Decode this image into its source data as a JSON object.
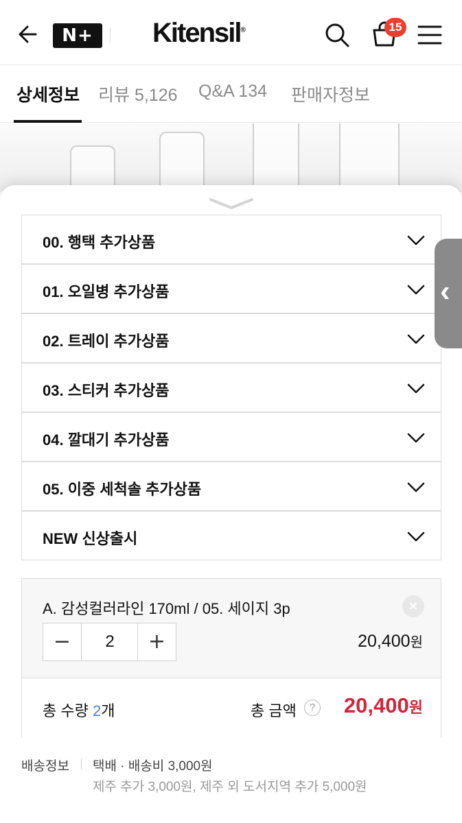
{
  "header": {
    "nplus_label": "N+",
    "logo_text": "Kitensil",
    "logo_mark": "®",
    "cart_count": "15",
    "icons": [
      "back-arrow-icon",
      "search-icon",
      "cart-icon",
      "hamburger-menu-icon"
    ]
  },
  "tabs": [
    {
      "label": "상세정보",
      "active": true
    },
    {
      "label": "리뷰 5,126",
      "active": false
    },
    {
      "label": "Q&A 134",
      "active": false
    },
    {
      "label": "판매자정보",
      "active": false
    }
  ],
  "options": [
    {
      "label": "00. 행택 추가상품"
    },
    {
      "label": "01. 오일병 추가상품"
    },
    {
      "label": "02. 트레이 추가상품"
    },
    {
      "label": "03. 스티커 추가상품"
    },
    {
      "label": "04. 깔대기 추가상품"
    },
    {
      "label": "05. 이중 세척솔 추가상품"
    },
    {
      "label": "NEW 신상출시"
    }
  ],
  "selected": {
    "name": "A. 감성컬러라인 170ml / 05. 세이지 3p",
    "minus": "−",
    "quantity": "2",
    "plus": "+",
    "price": "20,400",
    "price_unit": "원",
    "remove": "×"
  },
  "summary": {
    "qty_label": "총 수량 ",
    "qty_value": "2",
    "qty_unit": "개",
    "total_label": "총 금액",
    "help": "?",
    "total_price": "20,400",
    "total_unit": "원"
  },
  "shipping": {
    "label": "배송정보",
    "main": "택배 · 배송비 3,000원",
    "sub": "제주 추가 3,000원, 제주 외 도서지역 추가 5,000원"
  },
  "colors": {
    "accent_red": "#d0263a",
    "badge_red": "#e8412e",
    "qty_blue": "#4a7fd8"
  }
}
